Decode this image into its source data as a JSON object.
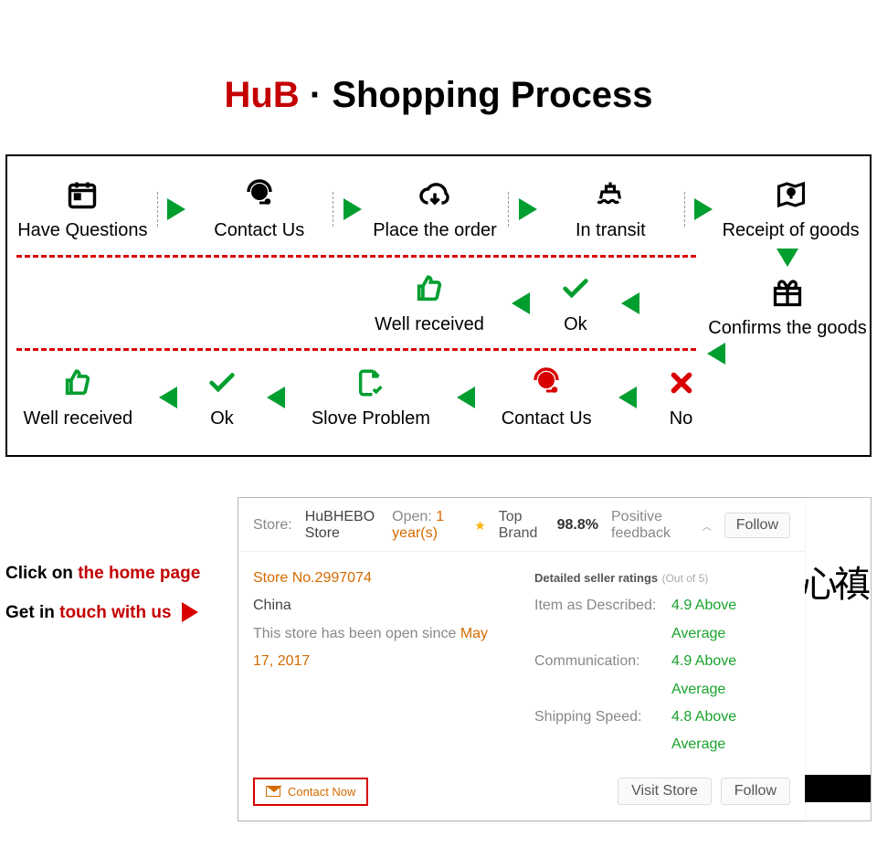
{
  "title": {
    "brand": "HuB",
    "sep": "·",
    "rest": "Shopping Process"
  },
  "flow": {
    "row1": [
      {
        "label": "Have Questions"
      },
      {
        "label": "Contact Us"
      },
      {
        "label": "Place the order"
      },
      {
        "label": "In transit"
      },
      {
        "label": "Receipt of goods"
      }
    ],
    "confirms": "Confirms the goods",
    "row2": [
      {
        "label": "Well received"
      },
      {
        "label": "Ok"
      }
    ],
    "row3": [
      {
        "label": "Well received"
      },
      {
        "label": "Ok"
      },
      {
        "label": "Slove Problem"
      },
      {
        "label": "Contact Us"
      },
      {
        "label": "No"
      }
    ]
  },
  "tips": {
    "line1a": "Click on ",
    "line1b": "the home page",
    "line2a": "Get in ",
    "line2b": "touch with us"
  },
  "store": {
    "store_label": "Store:",
    "store_name": "HuBHEBO Store",
    "open_label": "Open:",
    "open_value": "1 year(s)",
    "top_brand": "Top Brand",
    "pct": "98.8%",
    "pos_feedback": "Positive feedback",
    "follow": "Follow",
    "store_no": "Store No.2997074",
    "country": "China",
    "since_a": "This store has been open since ",
    "since_b": "May 17, 2017",
    "ratings_title": "Detailed seller ratings",
    "ratings_sub": "(Out of 5)",
    "ratings": [
      {
        "k": "Item as Described:",
        "v": "4.9 Above Average"
      },
      {
        "k": "Communication:",
        "v": "4.9 Above Average"
      },
      {
        "k": "Shipping Speed:",
        "v": "4.8 Above Average"
      }
    ],
    "contact_now": "Contact Now",
    "visit_store": "Visit Store",
    "follow2": "Follow"
  }
}
